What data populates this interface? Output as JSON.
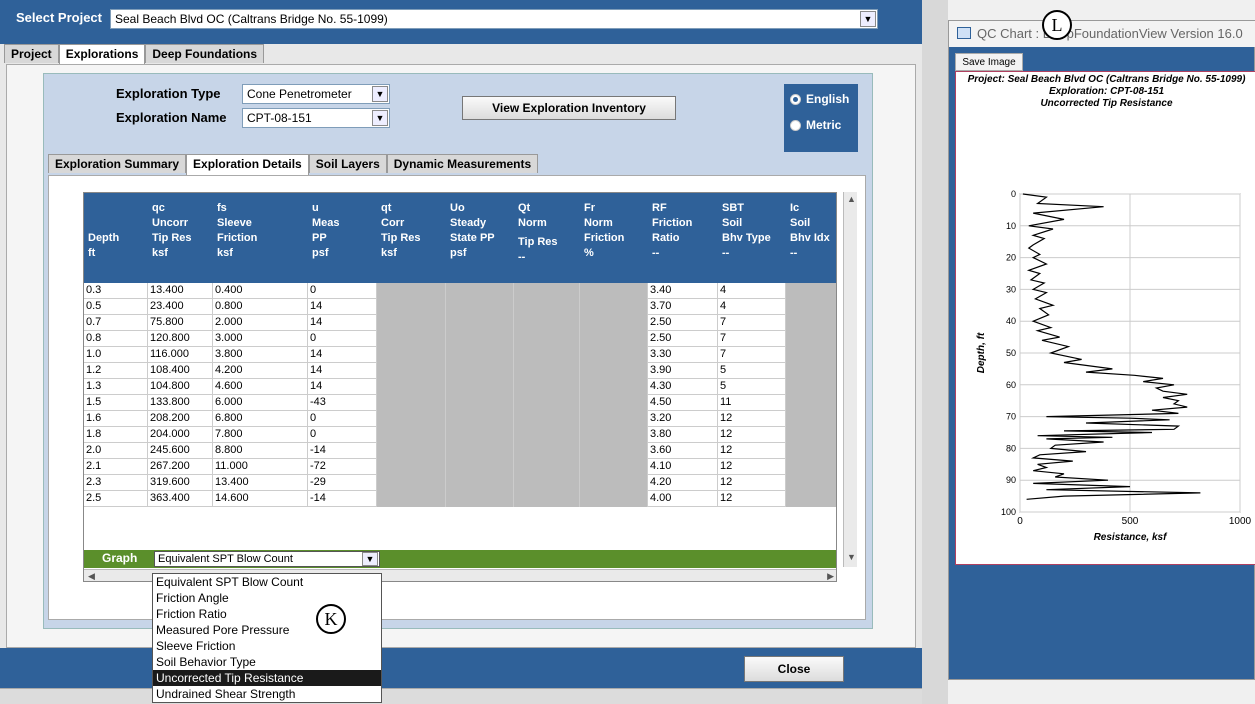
{
  "project": {
    "label": "Select Project",
    "value": "Seal Beach Blvd OC (Caltrans Bridge No. 55-1099)"
  },
  "top_tabs": [
    "Project",
    "Explorations",
    "Deep Foundations"
  ],
  "exploration": {
    "type_label": "Exploration Type",
    "type_value": "Cone Penetrometer",
    "name_label": "Exploration Name",
    "name_value": "CPT-08-151",
    "view_inventory": "View Exploration Inventory",
    "units": [
      "English",
      "Metric"
    ]
  },
  "sub_tabs": [
    "Exploration Summary",
    "Exploration Details",
    "Soil Layers",
    "Dynamic Measurements"
  ],
  "columns": [
    {
      "l1": "",
      "l2": "",
      "l3": "Depth",
      "l4": "ft"
    },
    {
      "l1": "qc",
      "l2": "Uncorr",
      "l3": "Tip Res",
      "l4": "ksf"
    },
    {
      "l1": "fs",
      "l2": "Sleeve",
      "l3": "Friction",
      "l4": "ksf"
    },
    {
      "l1": "u",
      "l2": "Meas",
      "l3": "PP",
      "l4": "psf"
    },
    {
      "l1": "qt",
      "l2": "Corr",
      "l3": "Tip Res",
      "l4": "ksf"
    },
    {
      "l1": "Uo",
      "l2": "Steady",
      "l3": "State PP",
      "l4": "psf"
    },
    {
      "l1": "Qt",
      "l2": "Norm",
      "l3": "",
      "l4": "--",
      "mid": "Tip Res"
    },
    {
      "l1": "Fr",
      "l2": "Norm",
      "l3": "Friction",
      "l4": "%"
    },
    {
      "l1": "RF",
      "l2": "Friction",
      "l3": "Ratio",
      "l4": "--"
    },
    {
      "l1": "SBT",
      "l2": "Soil",
      "l3": "Bhv Type",
      "l4": "--"
    },
    {
      "l1": "Ic",
      "l2": "Soil",
      "l3": "Bhv Idx",
      "l4": "--"
    }
  ],
  "rows": [
    [
      "0.3",
      "13.400",
      "0.400",
      "0",
      "3.40",
      "4"
    ],
    [
      "0.5",
      "23.400",
      "0.800",
      "14",
      "3.70",
      "4"
    ],
    [
      "0.7",
      "75.800",
      "2.000",
      "14",
      "2.50",
      "7"
    ],
    [
      "0.8",
      "120.800",
      "3.000",
      "0",
      "2.50",
      "7"
    ],
    [
      "1.0",
      "116.000",
      "3.800",
      "14",
      "3.30",
      "7"
    ],
    [
      "1.2",
      "108.400",
      "4.200",
      "14",
      "3.90",
      "5"
    ],
    [
      "1.3",
      "104.800",
      "4.600",
      "14",
      "4.30",
      "5"
    ],
    [
      "1.5",
      "133.800",
      "6.000",
      "-43",
      "4.50",
      "11"
    ],
    [
      "1.6",
      "208.200",
      "6.800",
      "0",
      "3.20",
      "12"
    ],
    [
      "1.8",
      "204.000",
      "7.800",
      "0",
      "3.80",
      "12"
    ],
    [
      "2.0",
      "245.600",
      "8.800",
      "-14",
      "3.60",
      "12"
    ],
    [
      "2.1",
      "267.200",
      "11.000",
      "-72",
      "4.10",
      "12"
    ],
    [
      "2.3",
      "319.600",
      "13.400",
      "-29",
      "4.20",
      "12"
    ],
    [
      "2.5",
      "363.400",
      "14.600",
      "-14",
      "4.00",
      "12"
    ]
  ],
  "graph": {
    "label": "Graph",
    "selected": "Equivalent SPT Blow Count",
    "options": [
      "Equivalent SPT Blow Count",
      "Friction Angle",
      "Friction Ratio",
      "Measured Pore Pressure",
      "Sleeve Friction",
      "Soil Behavior Type",
      "Uncorrected Tip Resistance",
      "Undrained Shear Strength"
    ]
  },
  "close_label": "Close",
  "callouts": {
    "k": "K",
    "l": "L"
  },
  "qc_window": {
    "title": "QC Chart : DeepFoundationView Version 16.0",
    "save": "Save Image"
  },
  "chart_data": {
    "type": "line",
    "title": "Project: Seal Beach Blvd OC (Caltrans Bridge No. 55-1099)",
    "subtitle1": "Exploration: CPT-08-151",
    "subtitle2": "Uncorrected Tip Resistance",
    "xlabel": "Resistance, ksf",
    "ylabel": "Depth, ft",
    "xlim": [
      0,
      1000
    ],
    "ylim": [
      0,
      100
    ],
    "y_reversed": true,
    "xticks": [
      "0",
      "500",
      "1000"
    ],
    "yticks": [
      "0",
      "10",
      "20",
      "30",
      "40",
      "50",
      "60",
      "70",
      "80",
      "90",
      "100"
    ],
    "grid": true,
    "series": [
      {
        "x": [
          13,
          120,
          80,
          380,
          60,
          200,
          40,
          150,
          60,
          110,
          60,
          40,
          90,
          60,
          120,
          40,
          90,
          50,
          110,
          60,
          120,
          70,
          150,
          90,
          130,
          60,
          140,
          80,
          180,
          100,
          220,
          140,
          280,
          200,
          420,
          300,
          520,
          650,
          560,
          700,
          620,
          650,
          760,
          650,
          720,
          700,
          760,
          600,
          720,
          120,
          500,
          680,
          300,
          720,
          700,
          200,
          600,
          80,
          420,
          120,
          380,
          160,
          140,
          300,
          90,
          60,
          240,
          80,
          120,
          60,
          200,
          160,
          400,
          60,
          500,
          120,
          820,
          200,
          30
        ],
        "y": [
          0,
          1,
          3,
          4,
          6,
          8,
          10,
          11,
          13,
          14,
          16,
          17,
          19,
          20,
          22,
          24,
          25,
          27,
          28,
          30,
          31,
          33,
          35,
          36,
          38,
          40,
          42,
          43,
          45,
          46,
          48,
          50,
          52,
          53,
          55,
          56,
          57,
          58,
          59,
          60,
          61,
          62,
          63,
          64,
          65,
          66,
          67,
          68,
          69,
          70,
          70.5,
          71,
          72,
          73,
          74,
          74.5,
          75,
          76,
          76.5,
          77,
          78,
          79,
          80,
          81,
          82,
          83,
          84,
          85,
          86,
          87,
          88,
          89,
          90,
          91,
          92,
          93,
          94,
          95,
          96
        ]
      }
    ]
  }
}
